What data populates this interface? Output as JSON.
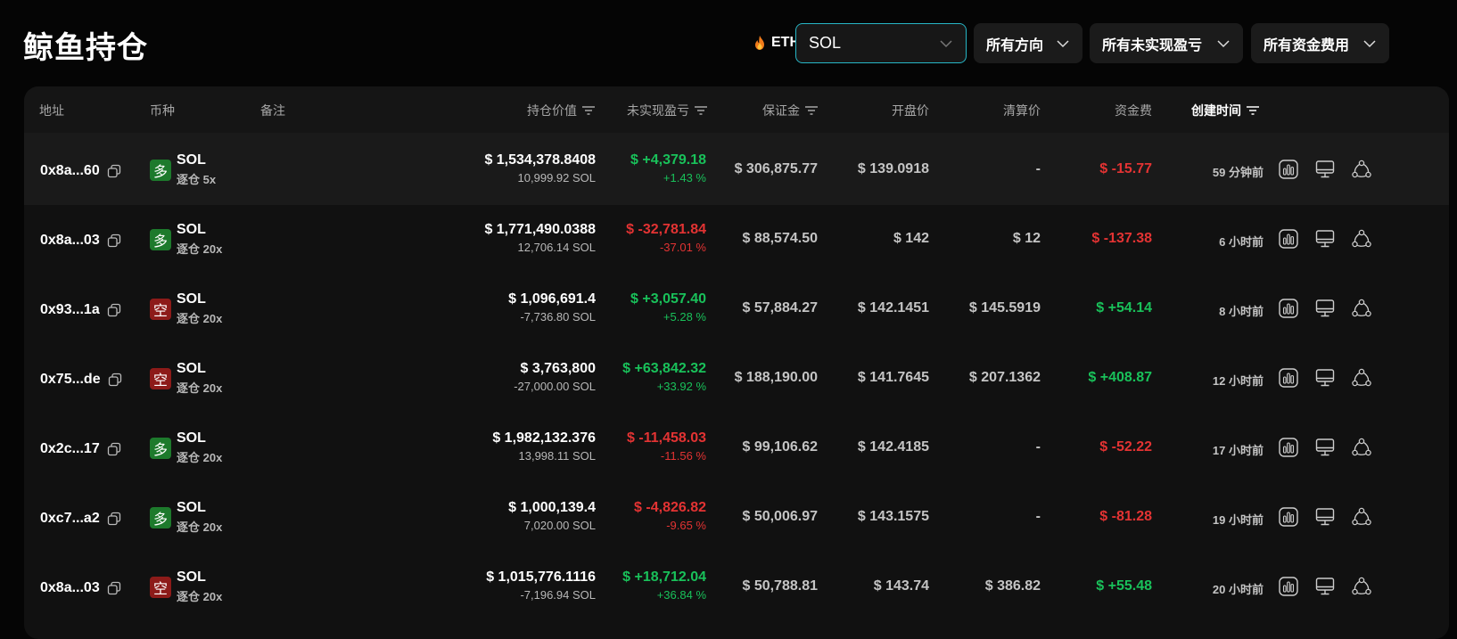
{
  "header": {
    "title": "鲸鱼持仓",
    "eth_label": "ETH",
    "coin_select_value": "SOL",
    "filter_direction": "所有方向",
    "filter_pnl": "所有未实现盈亏",
    "filter_funding": "所有资金费用"
  },
  "colors": {
    "positive": "#19c15a",
    "negative": "#e33333",
    "accent": "#27b6c6",
    "long_badge": "#1d7a2c",
    "short_badge": "#8d1b19"
  },
  "columns": {
    "address": "地址",
    "coin": "币种",
    "note": "备注",
    "position_value": "持仓价值",
    "unrealized_pnl": "未实现盈亏",
    "margin": "保证金",
    "open_price": "开盘价",
    "liq_price": "清算价",
    "funding": "资金费",
    "created": "创建时间"
  },
  "rows": [
    {
      "address": "0x8a...60",
      "side": "多",
      "side_type": "long",
      "coin": "SOL",
      "leverage": "逐仓 5x",
      "value": "$ 1,534,378.8408",
      "size": "10,999.92 SOL",
      "pnl": "$ +4,379.18",
      "pnl_pct": "+1.43 %",
      "pnl_sign": "pos",
      "margin": "$ 306,875.77",
      "open": "$ 139.0918",
      "liq": "-",
      "funding": "$ -15.77",
      "funding_sign": "neg",
      "time": "59 分钟前"
    },
    {
      "address": "0x8a...03",
      "side": "多",
      "side_type": "long",
      "coin": "SOL",
      "leverage": "逐仓 20x",
      "value": "$ 1,771,490.0388",
      "size": "12,706.14 SOL",
      "pnl": "$ -32,781.84",
      "pnl_pct": "-37.01 %",
      "pnl_sign": "neg",
      "margin": "$ 88,574.50",
      "open": "$ 142",
      "liq": "$ 12",
      "funding": "$ -137.38",
      "funding_sign": "neg",
      "time": "6 小时前"
    },
    {
      "address": "0x93...1a",
      "side": "空",
      "side_type": "short",
      "coin": "SOL",
      "leverage": "逐仓 20x",
      "value": "$ 1,096,691.4",
      "size": "-7,736.80 SOL",
      "pnl": "$ +3,057.40",
      "pnl_pct": "+5.28 %",
      "pnl_sign": "pos",
      "margin": "$ 57,884.27",
      "open": "$ 142.1451",
      "liq": "$ 145.5919",
      "funding": "$ +54.14",
      "funding_sign": "pos",
      "time": "8 小时前"
    },
    {
      "address": "0x75...de",
      "side": "空",
      "side_type": "short",
      "coin": "SOL",
      "leverage": "逐仓 20x",
      "value": "$ 3,763,800",
      "size": "-27,000.00 SOL",
      "pnl": "$ +63,842.32",
      "pnl_pct": "+33.92 %",
      "pnl_sign": "pos",
      "margin": "$ 188,190.00",
      "open": "$ 141.7645",
      "liq": "$ 207.1362",
      "funding": "$ +408.87",
      "funding_sign": "pos",
      "time": "12 小时前"
    },
    {
      "address": "0x2c...17",
      "side": "多",
      "side_type": "long",
      "coin": "SOL",
      "leverage": "逐仓 20x",
      "value": "$ 1,982,132.376",
      "size": "13,998.11 SOL",
      "pnl": "$ -11,458.03",
      "pnl_pct": "-11.56 %",
      "pnl_sign": "neg",
      "margin": "$ 99,106.62",
      "open": "$ 142.4185",
      "liq": "-",
      "funding": "$ -52.22",
      "funding_sign": "neg",
      "time": "17 小时前"
    },
    {
      "address": "0xc7...a2",
      "side": "多",
      "side_type": "long",
      "coin": "SOL",
      "leverage": "逐仓 20x",
      "value": "$ 1,000,139.4",
      "size": "7,020.00 SOL",
      "pnl": "$ -4,826.82",
      "pnl_pct": "-9.65 %",
      "pnl_sign": "neg",
      "margin": "$ 50,006.97",
      "open": "$ 143.1575",
      "liq": "-",
      "funding": "$ -81.28",
      "funding_sign": "neg",
      "time": "19 小时前"
    },
    {
      "address": "0x8a...03",
      "side": "空",
      "side_type": "short",
      "coin": "SOL",
      "leverage": "逐仓 20x",
      "value": "$ 1,015,776.1116",
      "size": "-7,196.94 SOL",
      "pnl": "$ +18,712.04",
      "pnl_pct": "+36.84 %",
      "pnl_sign": "pos",
      "margin": "$ 50,788.81",
      "open": "$ 143.74",
      "liq": "$ 386.82",
      "funding": "$ +55.48",
      "funding_sign": "pos",
      "time": "20 小时前"
    }
  ]
}
